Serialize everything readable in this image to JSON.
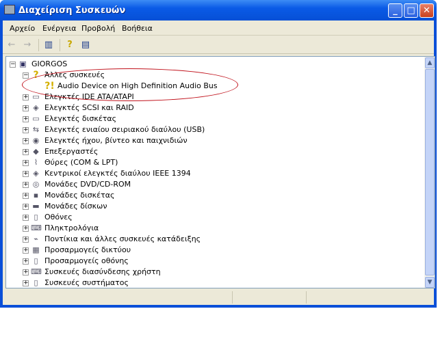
{
  "window": {
    "title": "Διαχείριση Συσκευών",
    "minimize": "_",
    "maximize": "□",
    "close": "✕"
  },
  "menu": [
    "Αρχείο",
    "Ενέργεια",
    "Προβολή",
    "Βοήθεια"
  ],
  "toolbar": {
    "back": "←",
    "forward": "→",
    "show_hide_tree": "▥",
    "help": "?",
    "properties": "▤"
  },
  "tree": {
    "root": "GIORGOS",
    "expanded": {
      "label": "Άλλες συσκευές",
      "children": [
        "Audio Device on High Definition Audio Bus"
      ]
    },
    "categories": [
      "Ελεγκτές IDE ATA/ATAPI",
      "Ελεγκτές SCSI και RAID",
      "Ελεγκτές δισκέτας",
      "Ελεγκτές ενιαίου σειριακού διαύλου (USB)",
      "Ελεγκτές ήχου, βίντεο και παιχνιδιών",
      "Επεξεργαστές",
      "Θύρες (COM & LPT)",
      "Κεντρικοί ελεγκτές διαύλου IEEE 1394",
      "Μονάδες DVD/CD-ROM",
      "Μονάδες δισκέτας",
      "Μονάδες δίσκων",
      "Οθόνες",
      "Πληκτρολόγια",
      "Ποντίκια και άλλες συσκευές κατάδειξης",
      "Προσαρμογείς δικτύου",
      "Προσαρμογείς οθόνης",
      "Συσκευές διασύνδεσης χρήστη",
      "Συσκευές συστήματος"
    ]
  },
  "expander": {
    "plus": "+",
    "minus": "−"
  },
  "scroll": {
    "up": "▲",
    "down": "▼"
  },
  "colors": {
    "titlebar": "#0a5ae6",
    "annotation": "#c0101a"
  }
}
